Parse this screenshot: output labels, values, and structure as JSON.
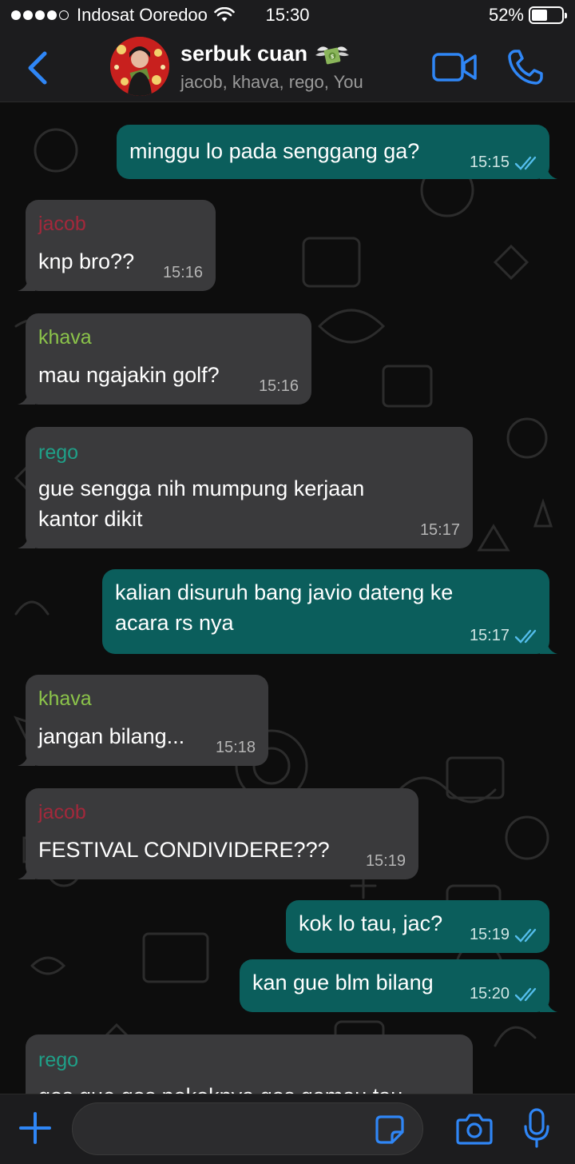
{
  "status_bar": {
    "carrier": "Indosat Ooredoo",
    "time": "15:30",
    "battery_percent": "52%",
    "battery_level": 0.52,
    "signal_bars_filled": 4,
    "signal_bars_total": 5
  },
  "header": {
    "group_name": "serbuk cuan",
    "group_emoji": "💸",
    "members": "jacob, khava, rego, You",
    "accent_color": "#2f86f6"
  },
  "messages": [
    {
      "direction": "out",
      "text": [
        "minggu lo pada senggang ga?"
      ],
      "time": "15:15",
      "status": "read-icon"
    },
    {
      "direction": "in",
      "sender": "jacob",
      "sender_color": "#a3283b",
      "text": [
        "knp bro??"
      ],
      "time": "15:16"
    },
    {
      "direction": "in",
      "sender": "khava",
      "sender_color": "#8bc34a",
      "text": [
        "mau ngajakin golf?"
      ],
      "time": "15:16"
    },
    {
      "direction": "in",
      "sender": "rego",
      "sender_color": "#1fa088",
      "text": [
        "gue sengga nih mumpung kerjaan",
        "kantor dikit"
      ],
      "time": "15:17"
    },
    {
      "direction": "out",
      "text": [
        "kalian disuruh bang javio dateng ke",
        "acara rs nya"
      ],
      "time": "15:17",
      "status": "read-icon"
    },
    {
      "direction": "in",
      "sender": "khava",
      "sender_color": "#8bc34a",
      "text": [
        "jangan bilang..."
      ],
      "time": "15:18"
    },
    {
      "direction": "in",
      "sender": "jacob",
      "sender_color": "#a3283b",
      "text": [
        "FESTIVAL CONDIVIDERE???"
      ],
      "time": "15:19"
    },
    {
      "direction": "out",
      "text": [
        "kok lo tau, jac?"
      ],
      "time": "15:19",
      "status": "read-icon"
    },
    {
      "direction": "out",
      "text": [
        "kan gue blm bilang"
      ],
      "time": "15:20",
      "status": "read-icon"
    },
    {
      "direction": "in",
      "sender": "rego",
      "sender_color": "#1fa088",
      "text": [
        "gos gue gos pokoknya gos gamau tau"
      ],
      "time": ""
    }
  ],
  "composer": {
    "placeholder": "",
    "value": ""
  },
  "colors": {
    "incoming_bubble": "#3a3a3c",
    "outgoing_bubble": "#0b5e5c",
    "read_ticks": "#53bdeb"
  }
}
